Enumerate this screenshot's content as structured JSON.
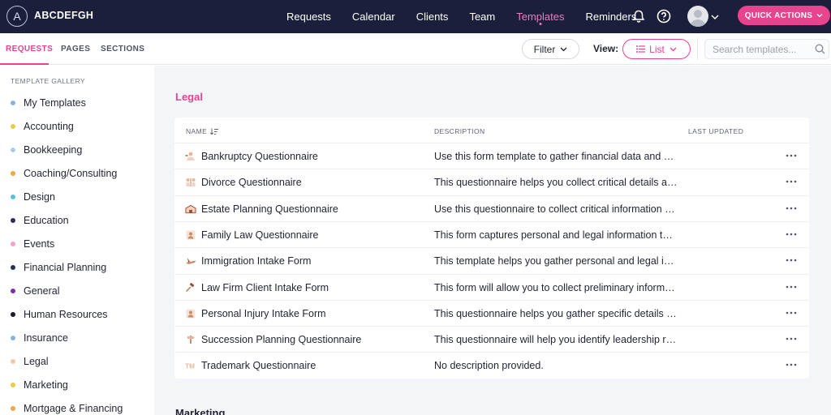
{
  "brand": {
    "logo_letter": "A",
    "name": "ABCDEFGH"
  },
  "nav": {
    "items": [
      {
        "label": "Requests",
        "active": false
      },
      {
        "label": "Calendar",
        "active": false
      },
      {
        "label": "Clients",
        "active": false
      },
      {
        "label": "Team",
        "active": false
      },
      {
        "label": "Templates",
        "active": true
      },
      {
        "label": "Reminders",
        "active": false
      }
    ],
    "notification_icon": "bell-icon",
    "help_icon": "help-circle-icon",
    "quick_actions_label": "QUICK ACTIONS"
  },
  "subnav": {
    "tabs": [
      {
        "label": "REQUESTS",
        "active": true
      },
      {
        "label": "PAGES",
        "active": false
      },
      {
        "label": "SECTIONS",
        "active": false
      }
    ],
    "filter_label": "Filter",
    "view_label": "View:",
    "view_mode": "List",
    "search_placeholder": "Search templates..."
  },
  "sidebar": {
    "title": "TEMPLATE GALLERY",
    "items": [
      {
        "label": "My Templates",
        "color": "#8ab4dc"
      },
      {
        "label": "Accounting",
        "color": "#ecc94b"
      },
      {
        "label": "Bookkeeping",
        "color": "#a9cfe6"
      },
      {
        "label": "Coaching/Consulting",
        "color": "#f0a83a"
      },
      {
        "label": "Design",
        "color": "#5bc0de"
      },
      {
        "label": "Education",
        "color": "#2d2f5a"
      },
      {
        "label": "Events",
        "color": "#f4a3c8"
      },
      {
        "label": "Financial Planning",
        "color": "#2d2f5a"
      },
      {
        "label": "General",
        "color": "#7b2fa8"
      },
      {
        "label": "Human Resources",
        "color": "#1a1a2e"
      },
      {
        "label": "Insurance",
        "color": "#8ab4dc"
      },
      {
        "label": "Legal",
        "color": "#f2c9a6"
      },
      {
        "label": "Marketing",
        "color": "#ecc94b"
      },
      {
        "label": "Mortgage & Financing",
        "color": "#e8a84a"
      }
    ]
  },
  "main": {
    "section_title": "Legal",
    "next_section_title": "Marketing",
    "columns": {
      "name": "NAME",
      "description": "DESCRIPTION",
      "last_updated": "LAST UPDATED"
    },
    "rows": [
      {
        "name": "Bankruptcy Questionnaire",
        "description": "Use this form template to gather financial data and circ...",
        "icon": "bankruptcy-icon"
      },
      {
        "name": "Divorce Questionnaire",
        "description": "This questionnaire helps you collect critical details abo...",
        "icon": "divorce-icon"
      },
      {
        "name": "Estate Planning Questionnaire",
        "description": "Use this questionnaire to collect critical information ab...",
        "icon": "house-icon"
      },
      {
        "name": "Family Law Questionnaire",
        "description": "This form captures personal and legal information to s...",
        "icon": "person-icon"
      },
      {
        "name": "Immigration Intake Form",
        "description": "This template helps you gather personal and legal infor...",
        "icon": "airplane-icon"
      },
      {
        "name": "Law Firm Client Intake Form",
        "description": "This form will allow you to collect preliminary informati...",
        "icon": "gavel-icon"
      },
      {
        "name": "Personal Injury Intake Form",
        "description": "This questionnaire helps you gather specific details abo...",
        "icon": "person-icon"
      },
      {
        "name": "Succession Planning Questionnaire",
        "description": "This questionnaire will help you identify leadership role...",
        "icon": "signpost-icon"
      },
      {
        "name": "Trademark Questionnaire",
        "description": "No description provided.",
        "icon": "trademark-icon"
      }
    ]
  }
}
